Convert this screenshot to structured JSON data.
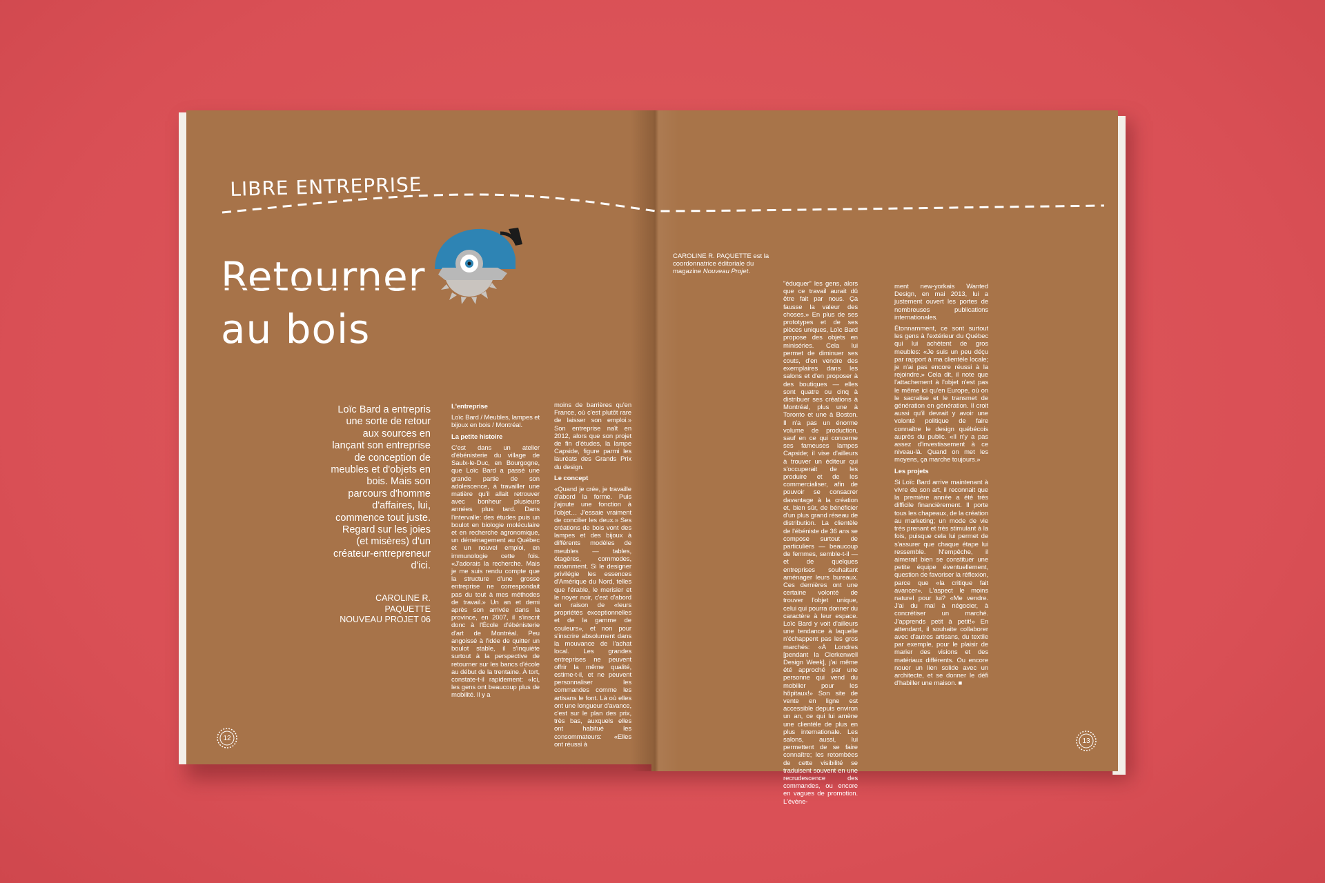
{
  "left_page": {
    "section_title": "LIBRE ENTREPRISE",
    "headline_line1": "Retourner",
    "headline_line2": "au bois",
    "intro": "Loïc Bard a entrepris une sorte de retour aux sources en lançant son entreprise de conception de meubles et d'objets en bois. Mais son parcours d'homme d'affaires, lui, commence tout juste. Regard sur les joies (et misères) d'un créateur-entrepreneur d'ici.",
    "byline_1": "CAROLINE R.",
    "byline_2": "PAQUETTE",
    "byline_3": "NOUVEAU PROJET 06",
    "page_number": "12",
    "col1": {
      "heading_1": "L'entreprise",
      "p_1": "Loïc Bard / Meubles, lampes et bijoux en bois / Montréal.",
      "heading_2": "La petite histoire",
      "p_2": "C'est dans un atelier d'ébénisterie du village de Saulx-le-Duc, en Bourgogne, que Loïc Bard a passé une grande partie de son adolescence, à travailler une matière qu'il allait retrouver avec bonheur plusieurs années plus tard. Dans l'intervalle: des études puis un boulot en biologie moléculaire et en recherche agronomique, un déménagement au Québec et un nouvel emploi, en immunologie cette fois. «J'adorais la recherche. Mais je me suis rendu compte que la structure d'une grosse entreprise ne correspondait pas du tout à mes méthodes de travail.» Un an et demi après son arrivée dans la province, en 2007, il s'inscrit donc à l'École d'ébénisterie d'art de Montréal. Peu angoissé à l'idée de quitter un boulot stable, il s'inquiète surtout à la perspective de retourner sur les bancs d'école au début de la trentaine. À tort, constate-t-il rapidement: «Ici, les gens ont beaucoup plus de mobilité. Il y a"
    },
    "col2": {
      "p_1": "moins de barrières qu'en France, où c'est plutôt rare de laisser son emploi.» Son entreprise naît en 2012, alors que son projet de fin d'études, la lampe Capside, figure parmi les lauréats des Grands Prix du design.",
      "heading_1": "Le concept",
      "p_2": "«Quand je crée, je travaille d'abord la forme. Puis j'ajoute une fonction à l'objet… J'essaie vraiment de concilier les deux.» Ses créations de bois vont des lampes et des bijoux à différents modèles de meubles — tables, étagères, commodes, notamment. Si le designer privilégie les essences d'Amérique du Nord, telles que l'érable, le merisier et le noyer noir, c'est d'abord en raison de «leurs propriétés exceptionnelles et de la gamme de couleurs», et non pour s'inscrire absolument dans la mouvance de l'achat local. Les grandes entreprises ne peuvent offrir la même qualité, estime-t-il, et ne peuvent personnaliser les commandes comme les artisans le font. Là où elles ont une longueur d'avance, c'est sur le plan des prix, très bas, auxquels elles ont habitué les consommateurs: «Elles ont réussi à"
    }
  },
  "right_page": {
    "author_note_name": "CAROLINE R. PAQUETTE",
    "author_note_rest": " est la coordonnatrice éditoriale du magazine ",
    "author_note_mag": "Nouveau Projet",
    "author_note_end": ".",
    "page_number": "13",
    "col3": {
      "p_1": "\"éduquer\" les gens, alors que ce travail aurait dû être fait par nous. Ça fausse la valeur des choses.» En plus de ses prototypes et de ses pièces uniques, Loïc Bard propose des objets en miniséries. Cela lui permet de diminuer ses couts, d'en vendre des exemplaires dans les salons et d'en proposer à des boutiques — elles sont quatre ou cinq à distribuer ses créations à Montréal, plus une à Toronto et une à Boston. Il n'a pas un énorme volume de production, sauf en ce qui concerne ses fameuses lampes Capside; il vise d'ailleurs à trouver un éditeur qui s'occuperait de les produire et de les commercialiser, afin de pouvoir se consacrer davantage à la création et, bien sûr, de bénéficier d'un plus grand réseau de distribution. La clientèle de l'ébéniste de 36 ans se compose surtout de particuliers — beaucoup de femmes, semble-t-il — et de quelques entreprises souhaitant aménager leurs bureaux. Ces dernières ont une certaine volonté de trouver l'objet unique, celui qui pourra donner du caractère à leur espace. Loïc Bard y voit d'ailleurs une tendance à laquelle n'échappent pas les gros marchés: «À Londres [pendant la Clerkenwell Design Week], j'ai même été approché par une personne qui vend du mobilier pour les hôpitaux!» Son site de vente en ligne est accessible depuis environ un an, ce qui lui amène une clientèle de plus en plus internationale. Les salons, aussi, lui permettent de se faire connaître; les retombées de cette visibilité se traduisent souvent en une recrudescence des commandes, ou encore en vagues de promotion. L'évène-"
    },
    "col4": {
      "p_1": "ment new-yorkais Wanted Design, en mai 2013, lui a justement ouvert les portes de nombreuses publications internationales.",
      "p_2": "Étonnamment, ce sont surtout les gens à l'extérieur du Québec qui lui achètent de gros meubles: «Je suis un peu déçu par rapport à ma clientèle locale; je n'ai pas encore réussi à la rejoindre.» Cela dit, il note que l'attachement à l'objet n'est pas le même ici qu'en Europe, où on le sacralise et le transmet de génération en génération. Il croit aussi qu'il devrait y avoir une volonté politique de faire connaître le design québécois auprès du public. «Il n'y a pas assez d'investissement à ce niveau-là. Quand on met les moyens, ça marche toujours.»",
      "heading_1": "Les projets",
      "p_3": "Si Loïc Bard arrive maintenant à vivre de son art, il reconnait que la première année a été très difficile financièrement. Il porte tous les chapeaux, de la création au marketing; un mode de vie très prenant et très stimulant à la fois, puisque cela lui permet de s'assurer que chaque étape lui ressemble. N'empêche, il aimerait bien se constituer une petite équipe éventuellement, question de favoriser la réflexion, parce que «la critique fait avancer». L'aspect le moins naturel pour lui? «Me vendre. J'ai du mal à négocier, à concrétiser un marché. J'apprends petit à petit!» En attendant, il souhaite collaborer avec d'autres artisans, du textile par exemple, pour le plaisir de marier des visions et des matériaux différents. Ou encore nouer un lien solide avec un architecte, et se donner le défi d'habiller une maison. ■"
    }
  },
  "colors": {
    "background": "#dc5459",
    "page": "#a77349",
    "saw_blue": "#2e84b4",
    "saw_grey": "#b8b8b8"
  }
}
